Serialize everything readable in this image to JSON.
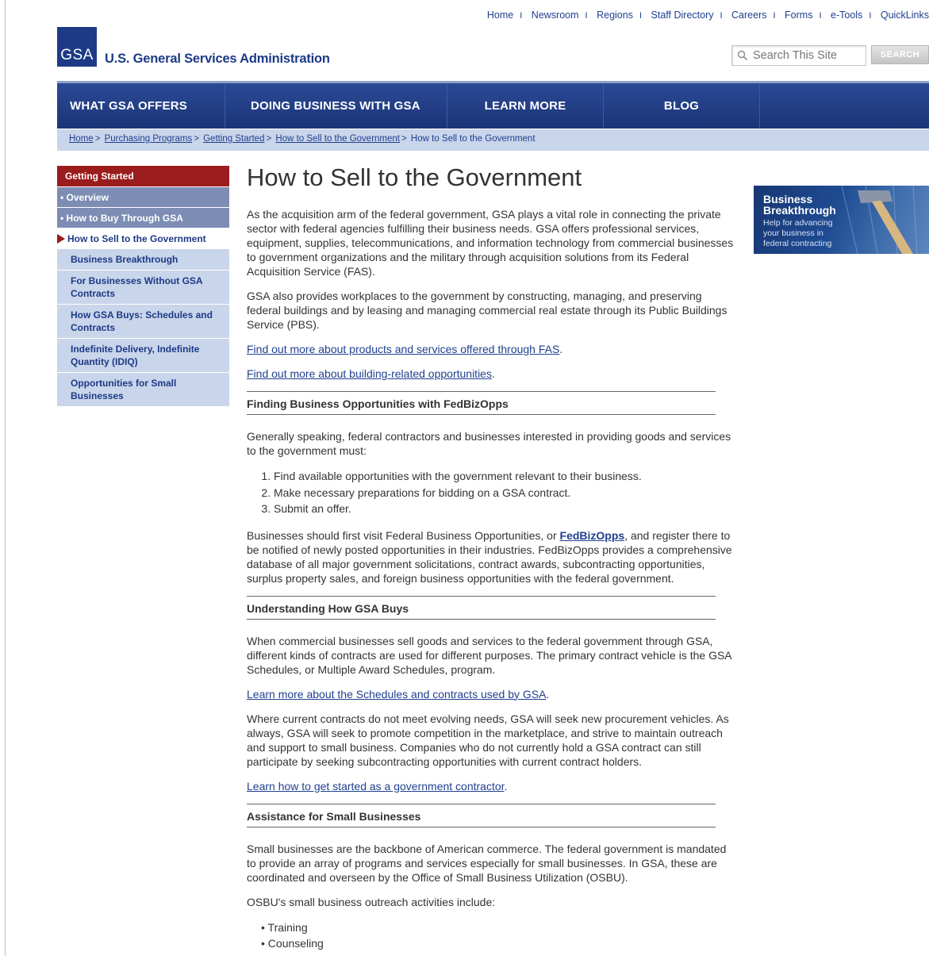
{
  "utility_nav": [
    "Home",
    "Newsroom",
    "Regions",
    "Staff Directory",
    "Careers",
    "Forms",
    "e-Tools",
    "QuickLinks"
  ],
  "logo": {
    "text": "GSA",
    "agency": "U.S. General Services Administration"
  },
  "search": {
    "placeholder": "Search This Site",
    "button": "SEARCH"
  },
  "main_nav": [
    "WHAT GSA OFFERS",
    "DOING BUSINESS WITH GSA",
    "LEARN MORE",
    "BLOG"
  ],
  "breadcrumb": [
    "Home",
    "Purchasing Programs",
    "Getting Started",
    "How to Sell to the Government",
    "How to Sell to the Government"
  ],
  "sidebar": {
    "heading": "Getting Started",
    "items": [
      "Overview",
      "How to Buy Through GSA",
      "How to Sell to the Government"
    ],
    "subitems": [
      "Business Breakthrough",
      "For Businesses Without GSA Contracts",
      "How GSA Buys: Schedules and Contracts",
      "Indefinite Delivery, Indefinite Quantity (IDIQ)",
      "Opportunities for Small Businesses"
    ]
  },
  "promo": {
    "title_1": "Business",
    "title_2": "Breakthrough",
    "sub_1": "Help for advancing",
    "sub_2": "your business in",
    "sub_3": "federal contracting"
  },
  "content": {
    "title": "How to Sell to the Government",
    "p1": "As the acquisition arm of the federal government, GSA plays a vital role in connecting the private sector with federal agencies fulfilling their business needs. GSA offers professional services, equipment, supplies, telecommunications, and information technology from commercial businesses to government organizations and the military through acquisition solutions from its Federal Acquisition Service (FAS).",
    "p2": "GSA also provides workplaces to the government by constructing, managing, and preserving federal buildings and by leasing and managing commercial real estate through its Public Buildings Service (PBS).",
    "link1": "Find out more about products and services offered through FAS",
    "link2": "Find out more about building-related opportunities",
    "h_fedbiz": "Finding Business Opportunities with FedBizOpps",
    "p3": "Generally speaking, federal contractors and businesses interested in providing goods and services to the government must:",
    "steps": [
      "Find available opportunities with the government relevant to their business.",
      "Make necessary preparations for bidding on a GSA contract.",
      "Submit an offer."
    ],
    "p4_before": "Businesses should first visit Federal Business Opportunities, or ",
    "p4_link": "FedBizOpps",
    "p4_after": ", and register there to be notified of newly posted opportunities in their industries. FedBizOpps provides a comprehensive database of all major government solicitations, contract awards, subcontracting opportunities, surplus property sales, and foreign business opportunities with the federal government.",
    "h_buys": "Understanding How GSA Buys",
    "p5": "When commercial businesses sell goods and services to the federal government through GSA, different kinds of contracts are used for different purposes. The primary contract vehicle is the GSA Schedules, or Multiple Award Schedules, program.",
    "link3": "Learn more about the Schedules and contracts used by GSA",
    "p6": "Where current contracts do not meet evolving needs, GSA will seek new procurement vehicles. As always, GSA will seek to promote competition in the marketplace, and strive to maintain outreach and support to small business. Companies who do not currently hold a GSA contract can still participate by seeking subcontracting opportunities with current contract holders.",
    "link4": "Learn how to get started as a government contractor",
    "h_small": "Assistance for Small Businesses",
    "p7": "Small businesses are the backbone of American commerce. The federal government is mandated to provide an array of programs and services especially for small businesses. In GSA, these are coordinated and overseen by the Office of Small Business Utilization (OSBU).",
    "p8": "OSBU's small business outreach activities include:",
    "bullets": [
      "Training",
      "Counseling"
    ]
  }
}
